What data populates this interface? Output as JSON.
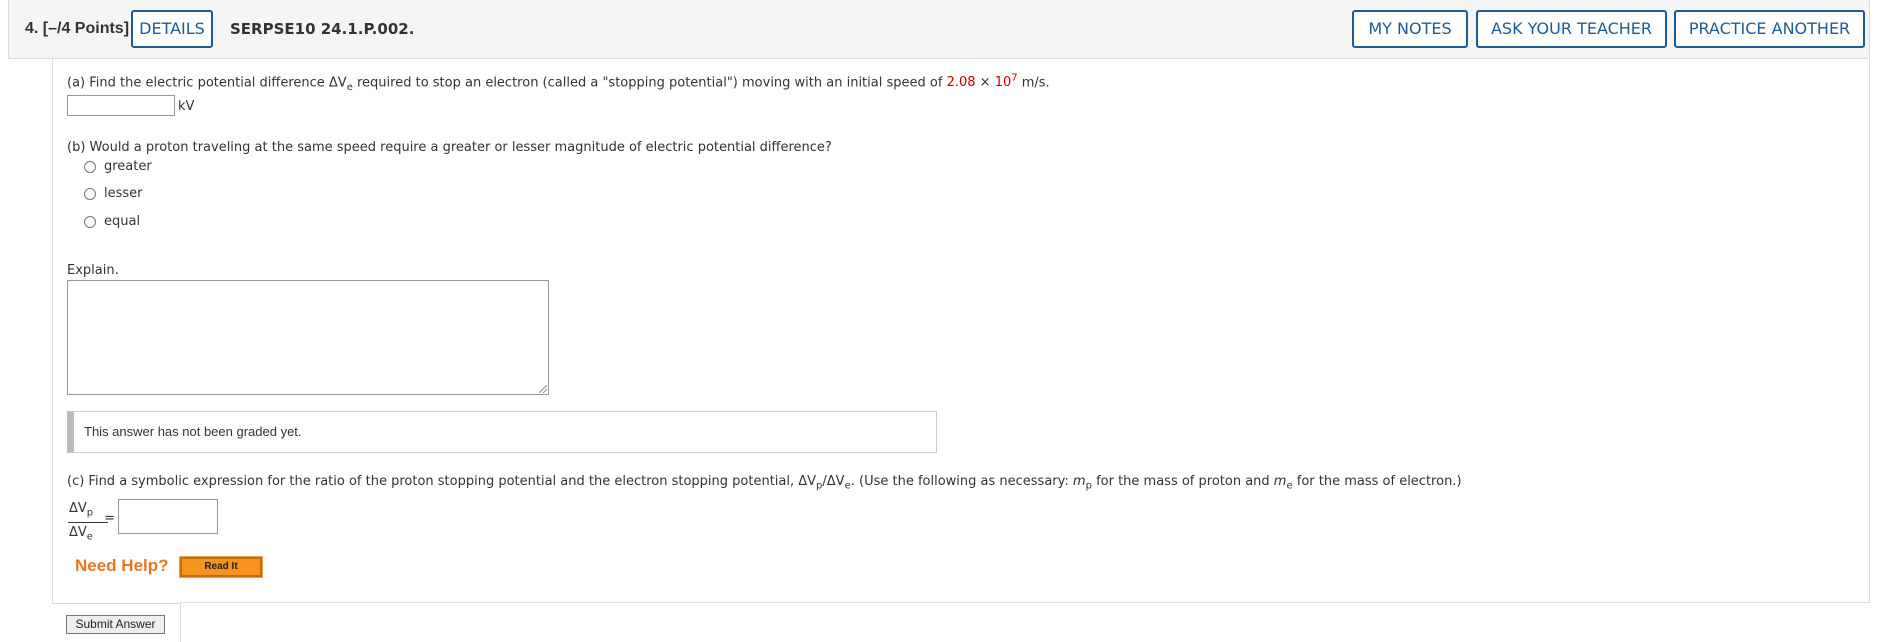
{
  "header": {
    "question_number": "4.  [–/4 Points]",
    "details_label": "DETAILS",
    "question_id": "SERPSE10 24.1.P.002.",
    "my_notes_label": "MY NOTES",
    "ask_teacher_label": "ASK YOUR TEACHER",
    "practice_another_label": "PRACTICE ANOTHER"
  },
  "part_a": {
    "text_1": "(a) Find the electric potential difference ΔV",
    "subscript": "e",
    "text_2": " required to stop an electron (called a \"stopping potential\") moving with an initial speed of ",
    "speed_mantissa": "2.08",
    "times": " × ",
    "speed_base": "10",
    "speed_exp": "7",
    "text_3": " m/s.",
    "unit": "kV",
    "answer_value": ""
  },
  "part_b": {
    "question": "(b) Would a proton traveling at the same speed require a greater or lesser magnitude of electric potential difference?",
    "options": [
      "greater",
      "lesser",
      "equal"
    ],
    "explain_label": "Explain.",
    "explain_value": "",
    "graded_message": "This answer has not been graded yet."
  },
  "part_c": {
    "text_1": "(c) Find a symbolic expression for the ratio of the proton stopping potential and the electron stopping potential, ΔV",
    "sub_p": "p",
    "slash": "/ΔV",
    "sub_e": "e",
    "text_2": ". (Use the following as necessary: ",
    "m_p": "m",
    "text_3": " for the mass of proton and ",
    "m_e": "m",
    "text_4": " for the mass of electron.)",
    "frac_num": "ΔV",
    "frac_num_sub": "p",
    "frac_den": "ΔV",
    "frac_den_sub": "e",
    "equals": "=",
    "answer_value": ""
  },
  "help": {
    "need_help_label": "Need Help?",
    "read_it_label": "Read It"
  },
  "submit_label": "Submit Answer",
  "colors": {
    "accent_blue": "#1d5c92",
    "highlight_red": "#cc0000",
    "help_orange": "#e87722",
    "read_it_orange": "#f7941d"
  }
}
